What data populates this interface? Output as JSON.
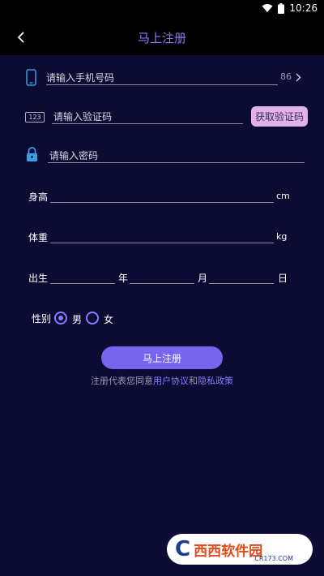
{
  "status": {
    "time": "10:26"
  },
  "header": {
    "title": "马上注册"
  },
  "form": {
    "phone": {
      "placeholder": "请输入手机号码",
      "country_code": "86"
    },
    "code": {
      "icon_text": "123",
      "placeholder": "请输入验证码",
      "get_code_label": "获取验证码"
    },
    "password": {
      "placeholder": "请输入密码"
    },
    "height": {
      "label": "身高",
      "unit": "cm"
    },
    "weight": {
      "label": "体重",
      "unit": "kg"
    },
    "birth": {
      "label": "出生",
      "year": "年",
      "month": "月",
      "day": "日"
    },
    "gender": {
      "label": "性别",
      "male": "男",
      "female": "女",
      "selected": "男"
    },
    "submit_label": "马上注册",
    "terms": {
      "prefix": "注册代表您同意",
      "user_agreement": "用户协议",
      "and": "和",
      "privacy": "隐私政策"
    }
  },
  "watermark": {
    "brand": "西西软件园",
    "sub": "CR173.COM",
    "letter": "C"
  },
  "colors": {
    "accent": "#8b7cff",
    "button": "#7765f0",
    "code_button": "#e2b3e9",
    "background": "#0b0b33"
  }
}
